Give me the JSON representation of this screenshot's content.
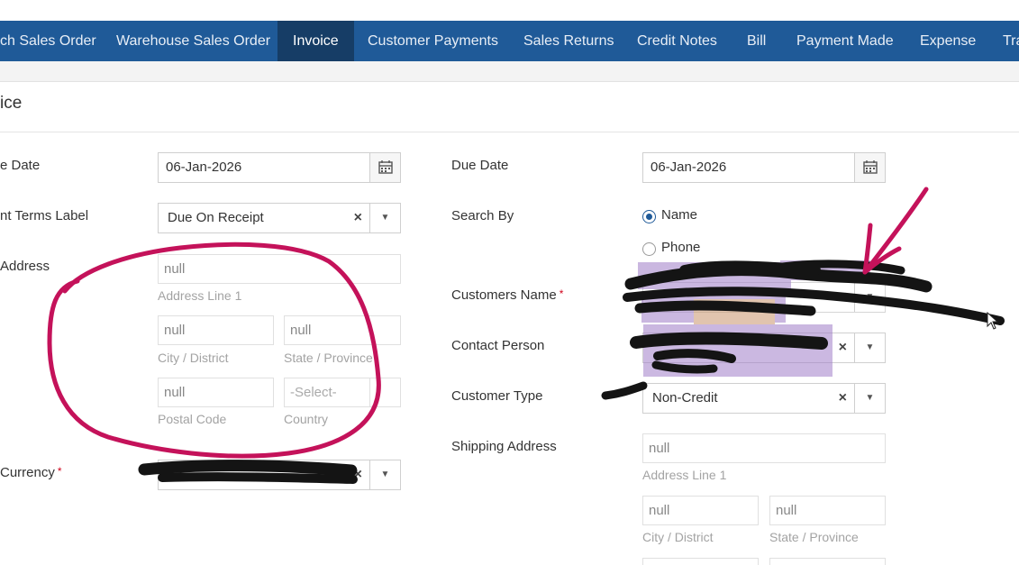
{
  "nav": {
    "items": [
      {
        "label": "ch Sales Order",
        "active": false
      },
      {
        "label": "Warehouse Sales Order",
        "active": false
      },
      {
        "label": "Invoice",
        "active": true
      },
      {
        "label": "Customer Payments",
        "active": false
      },
      {
        "label": "Sales Returns",
        "active": false
      },
      {
        "label": "Credit Notes",
        "active": false
      },
      {
        "label": "Bill",
        "active": false
      },
      {
        "label": "Payment Made",
        "active": false
      },
      {
        "label": "Expense",
        "active": false
      },
      {
        "label": "Tra",
        "active": false
      }
    ]
  },
  "page": {
    "title": "ice"
  },
  "left": {
    "invoice_date_label": "e Date",
    "invoice_date_value": "06-Jan-2026",
    "payment_terms_label": "nt Terms Label",
    "payment_terms_value": "Due On Receipt",
    "address_label": "Address",
    "address_line1": "null",
    "address_line1_hint": "Address Line 1",
    "city": "null",
    "city_hint": "City / District",
    "state": "null",
    "state_hint": "State / Province",
    "postal": "null",
    "postal_hint": "Postal Code",
    "country": "-Select-",
    "country_hint": "Country",
    "currency_label": "Currency",
    "required_mark": "*"
  },
  "right": {
    "due_date_label": "Due Date",
    "due_date_value": "06-Jan-2026",
    "search_by_label": "Search By",
    "search_name": "Name",
    "search_phone": "Phone",
    "customers_name_label": "Customers Name",
    "contact_person_label": "Contact Person",
    "customer_type_label": "Customer Type",
    "customer_type_value": "Non-Credit",
    "shipping_address_label": "Shipping Address",
    "ship_line1": "null",
    "ship_line1_hint": "Address Line 1",
    "ship_city": "null",
    "ship_city_hint": "City / District",
    "ship_state": "null",
    "ship_state_hint": "State / Province",
    "required_mark": "*"
  },
  "glyphs": {
    "clear": "×",
    "caret": "▼"
  },
  "colors": {
    "nav_bg": "#1f5a98",
    "nav_active": "#163d66",
    "annotation": "#c4125a",
    "highlight": "#a07ec8"
  }
}
